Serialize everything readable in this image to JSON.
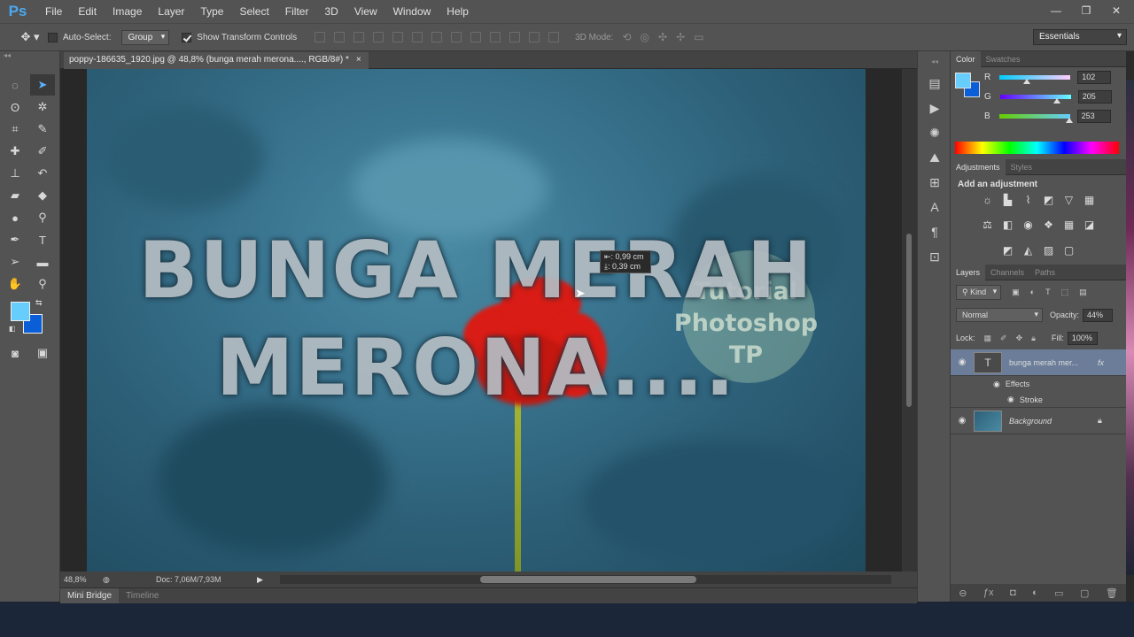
{
  "app": {
    "logo": "Ps"
  },
  "menu": [
    "File",
    "Edit",
    "Image",
    "Layer",
    "Type",
    "Select",
    "Filter",
    "3D",
    "View",
    "Window",
    "Help"
  ],
  "window_controls": {
    "minimize": "—",
    "restore": "❐",
    "close": "✕"
  },
  "options": {
    "auto_select_label": "Auto-Select:",
    "auto_select_checked": false,
    "auto_select_target": "Group",
    "show_transform_label": "Show Transform Controls",
    "show_transform_checked": true,
    "mode_3d_label": "3D Mode:",
    "workspace": "Essentials"
  },
  "document": {
    "tab_title": "poppy-186635_1920.jpg @ 48,8% (bunga  merah merona...., RGB/8#) *",
    "tab_close": "×",
    "title_line1": "BUNGA MERAH",
    "title_line2": "MERONA....",
    "watermark": [
      "Tutorial",
      "Photoshop",
      "TP"
    ],
    "tooltip_line1": "⇤: 0,99 cm",
    "tooltip_line2": "⤓: 0,39 cm",
    "zoom": "48,8%",
    "doc_size": "Doc: 7,06M/7,93M"
  },
  "bottom_tabs": {
    "mini_bridge": "Mini Bridge",
    "timeline": "Timeline"
  },
  "color_panel": {
    "tabs": {
      "color": "Color",
      "swatches": "Swatches"
    },
    "r_label": "R",
    "r": "102",
    "g_label": "G",
    "g": "205",
    "b_label": "B",
    "b": "253",
    "foreground": "#66CDFD",
    "background": "#0A5FD8"
  },
  "adjustments_panel": {
    "tabs": {
      "adjustments": "Adjustments",
      "styles": "Styles"
    },
    "heading": "Add an adjustment"
  },
  "layers_panel": {
    "tabs": {
      "layers": "Layers",
      "channels": "Channels",
      "paths": "Paths"
    },
    "filter_kind": "Kind",
    "blend_mode": "Normal",
    "opacity_label": "Opacity:",
    "opacity": "44%",
    "lock_label": "Lock:",
    "fill_label": "Fill:",
    "fill": "100%",
    "layers": [
      {
        "name": "bunga  merah mer...",
        "type": "text",
        "fx": "fx"
      },
      {
        "name": "Background",
        "type": "image",
        "locked": true
      }
    ],
    "effects_label": "Effects",
    "stroke_label": "Stroke"
  }
}
